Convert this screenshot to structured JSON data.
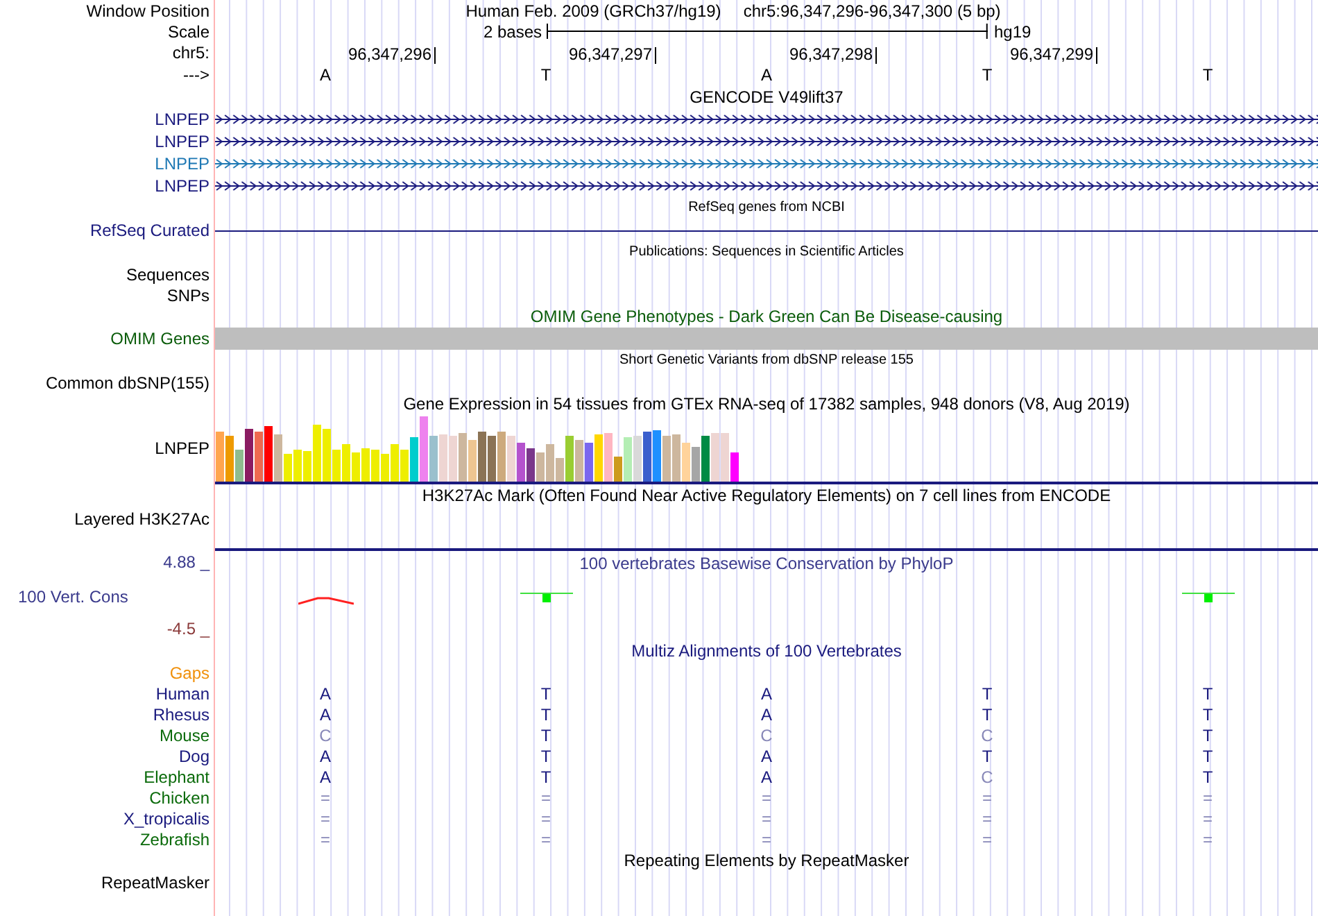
{
  "rows": [
    {
      "kind": "position",
      "label": "Window Position",
      "assembly": "Human Feb. 2009 (GRCh37/hg19)",
      "position": "chr5:96,347,296-96,347,300 (5 bp)"
    },
    {
      "kind": "scale",
      "label": "Scale",
      "span": "2 bases",
      "assembly": "hg19"
    },
    {
      "kind": "ruler",
      "label": "chr5:",
      "ticks": [
        "96,347,296",
        "96,347,297",
        "96,347,298",
        "96,347,299"
      ]
    },
    {
      "kind": "bases",
      "label": "--->",
      "bases": [
        "A",
        "T",
        "A",
        "T",
        "T"
      ]
    },
    {
      "kind": "title",
      "text": "GENCODE V49lift37"
    },
    {
      "kind": "gene",
      "label": "LNPEP",
      "color": "#1a1a7e"
    },
    {
      "kind": "gene",
      "label": "LNPEP",
      "color": "#1a1a7e"
    },
    {
      "kind": "gene",
      "label": "LNPEP",
      "color": "#1e78b4"
    },
    {
      "kind": "gene",
      "label": "LNPEP",
      "color": "#1a1a7e"
    },
    {
      "kind": "small_title",
      "text": "RefSeq genes from NCBI"
    },
    {
      "kind": "line",
      "label": "RefSeq Curated",
      "color": "#1a1a7e"
    },
    {
      "kind": "small_title",
      "text": "Publications: Sequences in Scientific Articles"
    },
    {
      "kind": "label",
      "label": "Sequences"
    },
    {
      "kind": "label",
      "label": "SNPs"
    },
    {
      "kind": "omim_title",
      "text": "OMIM Gene Phenotypes - Dark Green Can Be Disease-causing"
    },
    {
      "kind": "bar",
      "label": "OMIM Genes",
      "color": "#0a5c0a"
    },
    {
      "kind": "small_title",
      "text": "Short Genetic Variants from dbSNP release 155"
    },
    {
      "kind": "label",
      "label": "Common dbSNP(155)"
    },
    {
      "kind": "title",
      "text": "Gene Expression in 54 tissues from GTEx RNA-seq of 17382 samples, 948 donors (V8, Aug 2019)"
    },
    {
      "kind": "expression",
      "label": "LNPEP"
    },
    {
      "kind": "title",
      "divider": true,
      "text": "H3K27Ac Mark (Often Found Near Active Regulatory Elements) on 7 cell lines from ENCODE"
    },
    {
      "kind": "tall",
      "label": "Layered H3K27Ac"
    },
    {
      "kind": "phylop",
      "max": "4.88 _",
      "title": "100 vertebrates Basewise Conservation by PhyloP",
      "label": "100 Vert. Cons",
      "min": "-4.5 _"
    },
    {
      "kind": "multiz_title",
      "text": "Multiz Alignments of 100 Vertebrates"
    },
    {
      "kind": "label",
      "label": "Gaps",
      "color": "#f0900a"
    },
    {
      "kind": "species",
      "label": "Human",
      "color": "#1a1a7e",
      "bases": [
        {
          "base": "A",
          "match": true
        },
        {
          "base": "T",
          "match": true
        },
        {
          "base": "A",
          "match": true
        },
        {
          "base": "T",
          "match": true
        },
        {
          "base": "T",
          "match": true
        }
      ]
    },
    {
      "kind": "species",
      "label": "Rhesus",
      "color": "#1a1a7e",
      "bases": [
        {
          "base": "A",
          "match": true
        },
        {
          "base": "T",
          "match": true
        },
        {
          "base": "A",
          "match": true
        },
        {
          "base": "T",
          "match": true
        },
        {
          "base": "T",
          "match": true
        }
      ]
    },
    {
      "kind": "species",
      "label": "Mouse",
      "color": "#0a6a0a",
      "bases": [
        {
          "base": "C",
          "match": false
        },
        {
          "base": "T",
          "match": true
        },
        {
          "base": "C",
          "match": false
        },
        {
          "base": "C",
          "match": false
        },
        {
          "base": "T",
          "match": true
        }
      ]
    },
    {
      "kind": "species",
      "label": "Dog",
      "color": "#1a1a7e",
      "bases": [
        {
          "base": "A",
          "match": true
        },
        {
          "base": "T",
          "match": true
        },
        {
          "base": "A",
          "match": true
        },
        {
          "base": "T",
          "match": true
        },
        {
          "base": "T",
          "match": true
        }
      ]
    },
    {
      "kind": "species",
      "label": "Elephant",
      "color": "#0a6a0a",
      "bases": [
        {
          "base": "A",
          "match": true
        },
        {
          "base": "T",
          "match": true
        },
        {
          "base": "A",
          "match": true
        },
        {
          "base": "C",
          "match": false
        },
        {
          "base": "T",
          "match": true
        }
      ]
    },
    {
      "kind": "species",
      "label": "Chicken",
      "color": "#0a6a0a",
      "bases": [
        {
          "base": "=",
          "match": false
        },
        {
          "base": "=",
          "match": false
        },
        {
          "base": "=",
          "match": false
        },
        {
          "base": "=",
          "match": false
        },
        {
          "base": "=",
          "match": false
        }
      ]
    },
    {
      "kind": "species",
      "label": "X_tropicalis",
      "color": "#1a1a7e",
      "bases": [
        {
          "base": "=",
          "match": false
        },
        {
          "base": "=",
          "match": false
        },
        {
          "base": "=",
          "match": false
        },
        {
          "base": "=",
          "match": false
        },
        {
          "base": "=",
          "match": false
        }
      ]
    },
    {
      "kind": "species",
      "label": "Zebrafish",
      "color": "#0a6a0a",
      "bases": [
        {
          "base": "=",
          "match": false
        },
        {
          "base": "=",
          "match": false
        },
        {
          "base": "=",
          "match": false
        },
        {
          "base": "=",
          "match": false
        },
        {
          "base": "=",
          "match": false
        }
      ]
    },
    {
      "kind": "title",
      "text": "Repeating Elements by RepeatMasker"
    },
    {
      "kind": "label",
      "label": "RepeatMasker"
    }
  ]
}
